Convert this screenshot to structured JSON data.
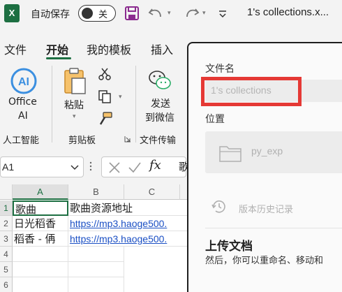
{
  "titlebar": {
    "app_logo": "X",
    "autosave_label": "自动保存",
    "autosave_state": "关",
    "icons": [
      "excel-logo-icon",
      "save-icon",
      "undo-icon",
      "redo-icon",
      "qat-customize-icon"
    ],
    "document_title": "1's collections.x..."
  },
  "tabs": [
    {
      "label": "文件"
    },
    {
      "label": "开始",
      "active": true
    },
    {
      "label": "我的模板"
    },
    {
      "label": "插入"
    }
  ],
  "ribbon": {
    "ai": {
      "label_line1": "Office",
      "label_line2": "AI",
      "group": "人工智能"
    },
    "clipboard": {
      "paste": "粘贴",
      "group": "剪贴板"
    },
    "transfer": {
      "line1": "发送",
      "line2": "到微信",
      "group": "文件传输"
    }
  },
  "formula_bar": {
    "name_box": "A1",
    "content": "歌"
  },
  "sheet": {
    "columns": [
      "A",
      "B",
      "C"
    ],
    "rows": [
      "1",
      "2",
      "3",
      "4",
      "5",
      "6"
    ],
    "cells": [
      {
        "a": "歌曲",
        "b": "歌曲资源地址"
      },
      {
        "a": "日光稻香",
        "b": "https://mp3.haoge500."
      },
      {
        "a": "稻香 - 侢",
        "b": "https://mp3.haoge500."
      }
    ]
  },
  "save_panel": {
    "filename_label": "文件名",
    "filename_value": "1's collections",
    "location_label": "位置",
    "location_value": "py_exp",
    "version_history": "版本历史记录",
    "upload_title": "上传文档",
    "upload_desc": "然后，你可以重命名、移动和",
    "highlight_color": "#e53935"
  },
  "colors": {
    "accent": "#1d6f42",
    "link": "#1a4fc4"
  }
}
